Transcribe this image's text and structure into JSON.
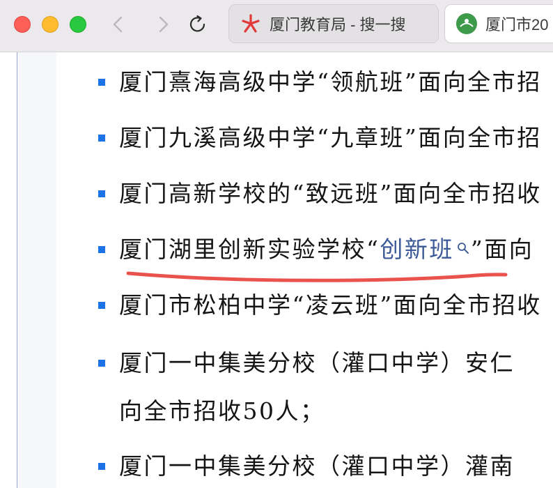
{
  "browser": {
    "tabs": [
      {
        "label": "厦门教育局 - 搜一搜",
        "icon": "sogou-sousuo-icon"
      },
      {
        "label": "厦门市20",
        "icon": "xiamen-education-icon"
      }
    ],
    "nav": {
      "back": "back-icon",
      "forward": "forward-icon",
      "reload": "reload-icon"
    }
  },
  "list": {
    "items": [
      {
        "text": "厦门熹海高级中学“领航班”面向全市招"
      },
      {
        "text": "厦门九溪高级中学“九章班”面向全市招"
      },
      {
        "text": "厦门高新学校的“致远班”面向全市招收"
      },
      {
        "prefix": "厦门湖里创新实验学校“",
        "link": "创新班",
        "suffix": "”面向"
      },
      {
        "text": "厦门市松柏中学“凌云班”面向全市招收"
      },
      {
        "text": "厦门一中集美分校（灌口中学）安仁",
        "continuation": "向全市招收50人；"
      },
      {
        "text": "厦门一中集美分校（灌口中学）灌南"
      }
    ]
  },
  "colors": {
    "bullet": "#1d72e8",
    "link": "#3c5a97",
    "annotation_underline": "#e8403a"
  }
}
